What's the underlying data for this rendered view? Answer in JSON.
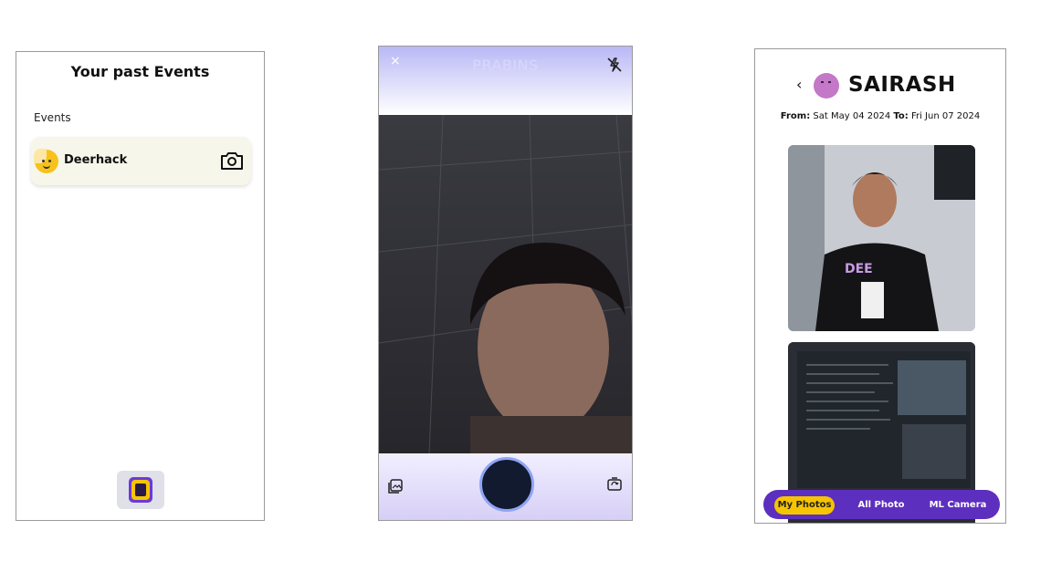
{
  "screen1": {
    "title": "Your past Events",
    "section_label": "Events",
    "events": [
      {
        "name": "Deerhack",
        "icon": "camera-icon"
      }
    ],
    "bottom_icon": "app-logo-icon"
  },
  "screen2": {
    "close_label": "×",
    "title": "PRABINS",
    "flash_icon": "flash-off-icon",
    "gallery_icon": "gallery-icon",
    "flip_icon": "flip-camera-icon"
  },
  "screen3": {
    "back_label": "‹",
    "name": "SAIRASH",
    "from_label": "From:",
    "from_date": "Sat May 04 2024",
    "to_label": "To:",
    "to_date": "Fri Jun 07 2024",
    "tabs": [
      {
        "label": "My Photos",
        "active": true
      },
      {
        "label": "All Photo",
        "active": false
      },
      {
        "label": "ML Camera",
        "active": false
      }
    ],
    "colors": {
      "tab_bar": "#5d2fbf",
      "active_tab": "#f6c400"
    }
  }
}
